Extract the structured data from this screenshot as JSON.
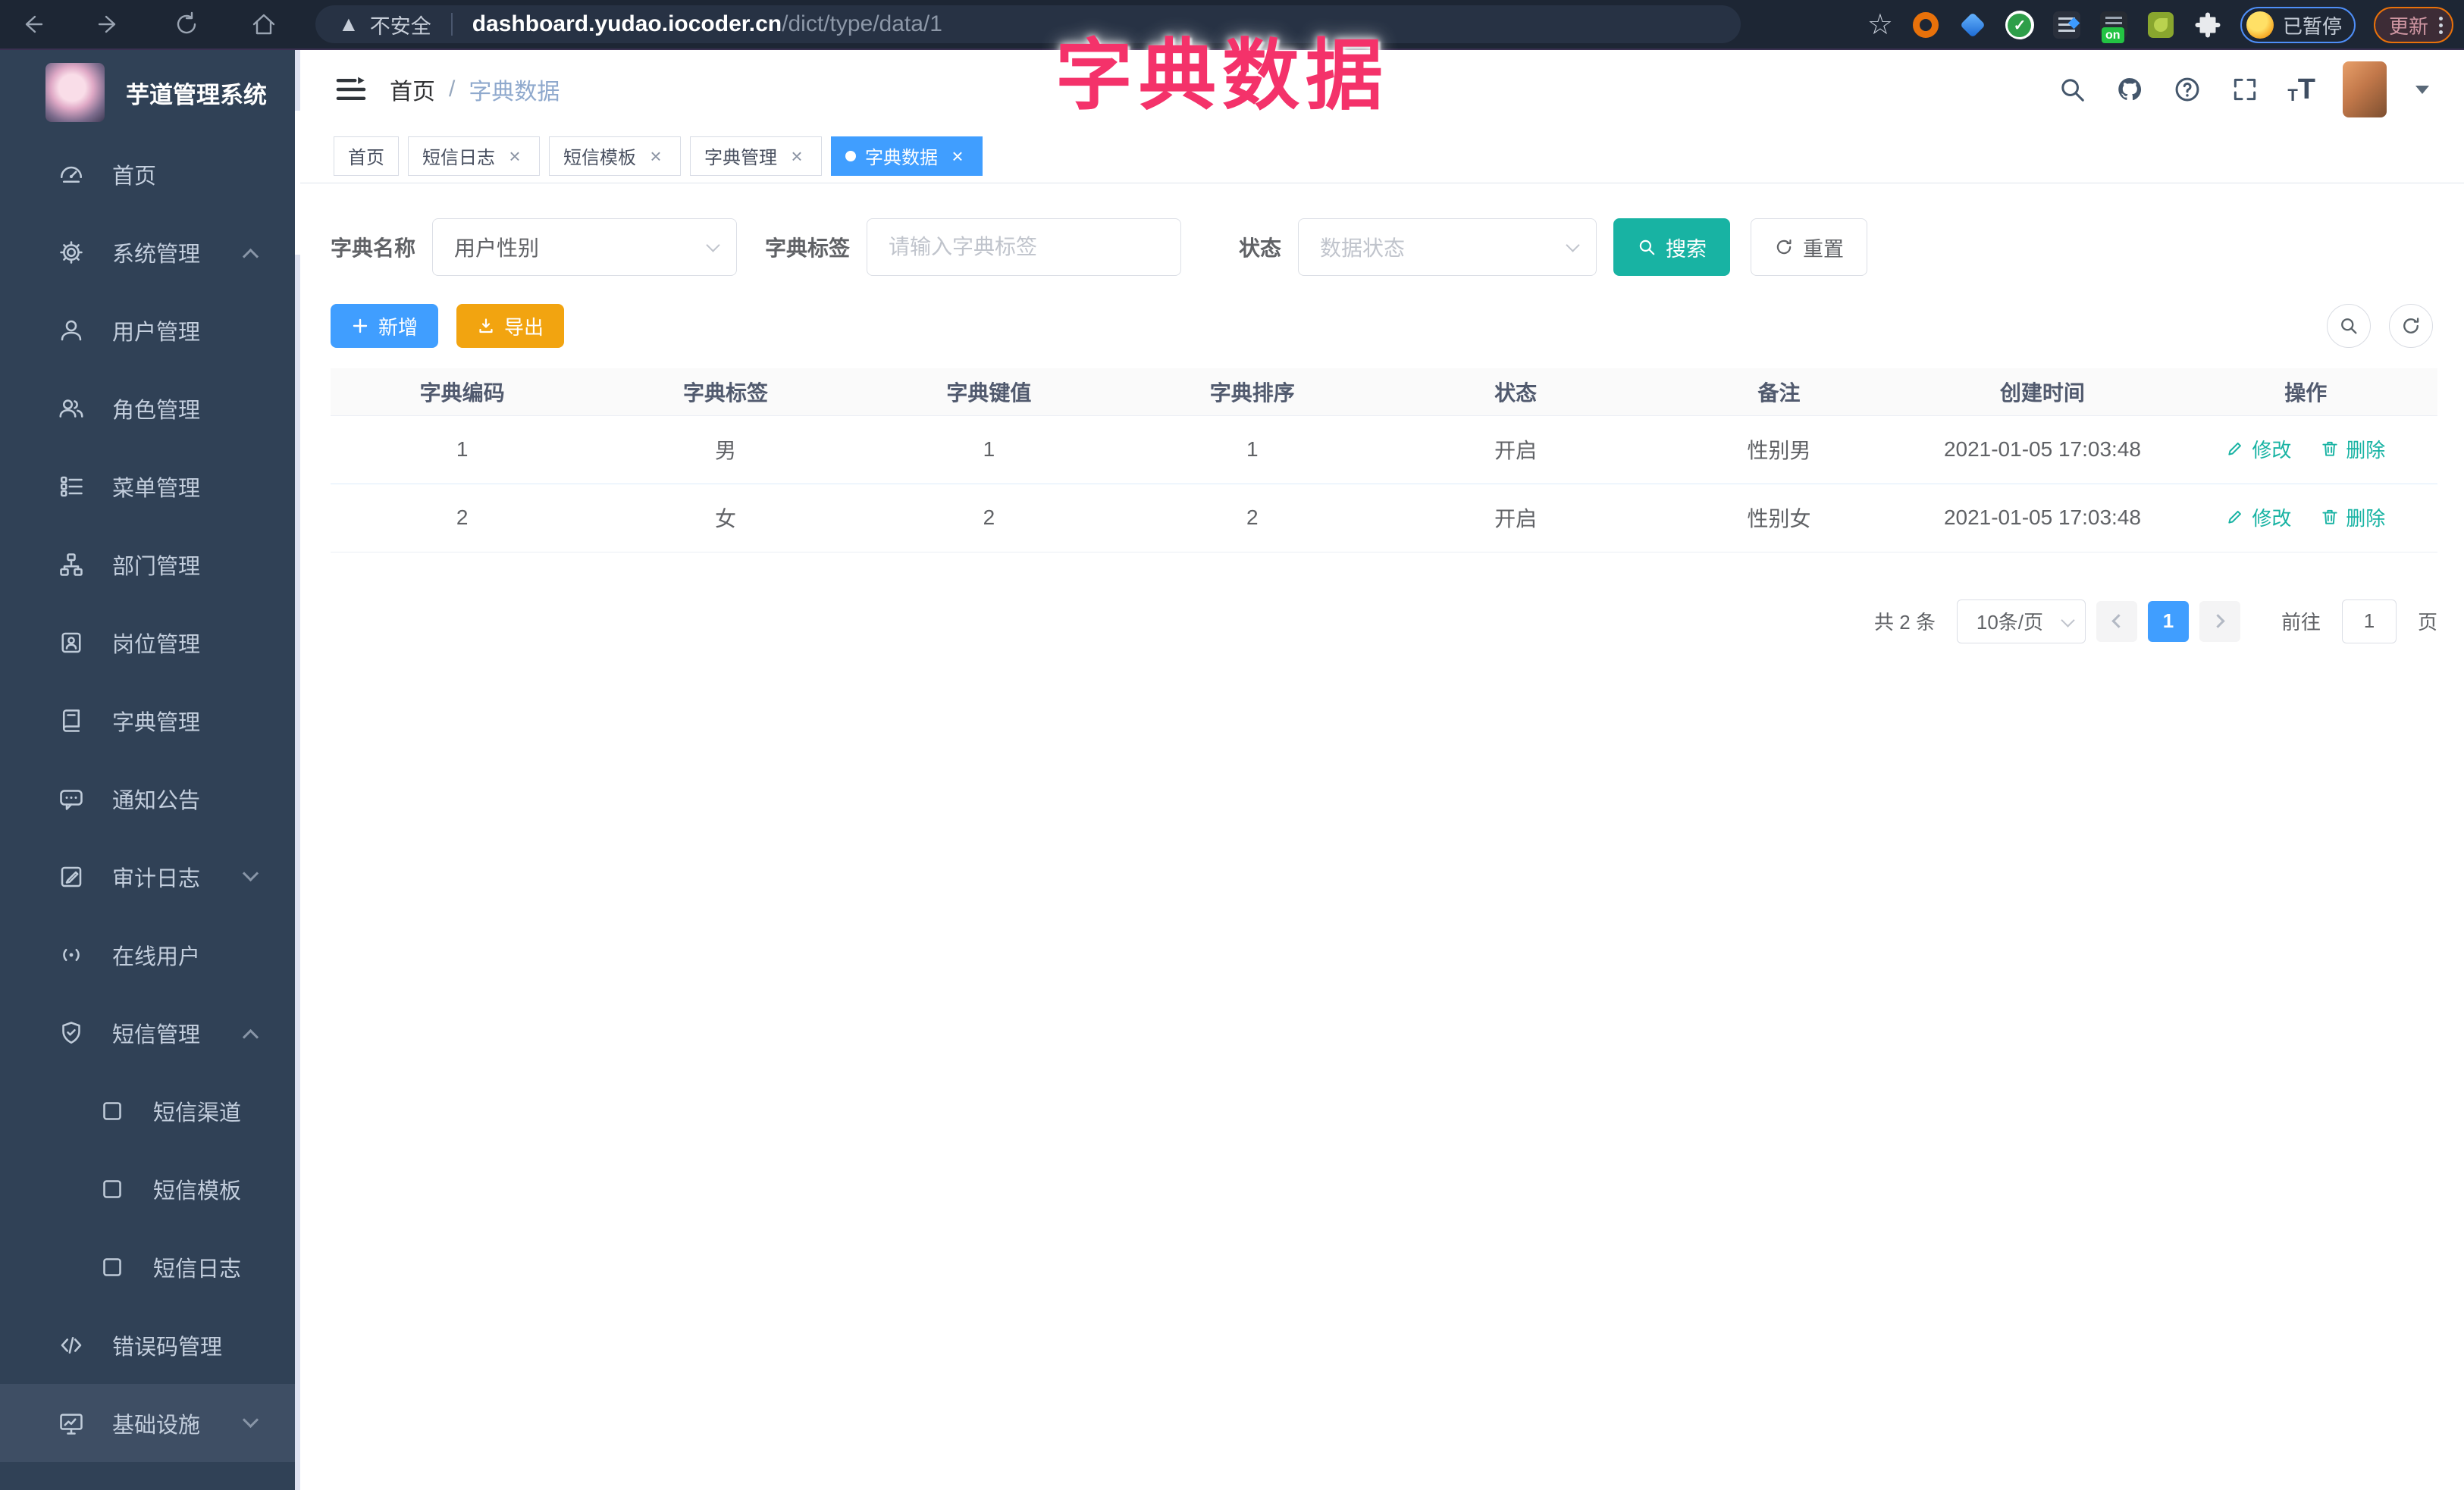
{
  "browser": {
    "security_label": "不安全",
    "url_host": "dashboard.yudao.iocoder.cn",
    "url_path": "/dict/type/data/1",
    "on_badge": "on",
    "paused_label": "已暂停",
    "update_label": "更新"
  },
  "overlay": {
    "title": "字典数据"
  },
  "sidebar": {
    "app_title": "芋道管理系统",
    "items": [
      {
        "label": "首页"
      },
      {
        "label": "系统管理"
      },
      {
        "label": "用户管理"
      },
      {
        "label": "角色管理"
      },
      {
        "label": "菜单管理"
      },
      {
        "label": "部门管理"
      },
      {
        "label": "岗位管理"
      },
      {
        "label": "字典管理"
      },
      {
        "label": "通知公告"
      },
      {
        "label": "审计日志"
      },
      {
        "label": "在线用户"
      },
      {
        "label": "短信管理"
      },
      {
        "label": "短信渠道"
      },
      {
        "label": "短信模板"
      },
      {
        "label": "短信日志"
      },
      {
        "label": "错误码管理"
      },
      {
        "label": "基础设施"
      }
    ]
  },
  "breadcrumb": {
    "home": "首页",
    "separator": "/",
    "current": "字典数据"
  },
  "tabs": [
    {
      "label": "首页"
    },
    {
      "label": "短信日志"
    },
    {
      "label": "短信模板"
    },
    {
      "label": "字典管理"
    },
    {
      "label": "字典数据"
    }
  ],
  "filters": {
    "name_label": "字典名称",
    "name_value": "用户性别",
    "tag_label": "字典标签",
    "tag_placeholder": "请输入字典标签",
    "status_label": "状态",
    "status_placeholder": "数据状态",
    "search_label": "搜索",
    "reset_label": "重置"
  },
  "toolbar": {
    "add_label": "新增",
    "export_label": "导出"
  },
  "table": {
    "headers": [
      "字典编码",
      "字典标签",
      "字典键值",
      "字典排序",
      "状态",
      "备注",
      "创建时间",
      "操作"
    ],
    "rows": [
      {
        "code": "1",
        "label": "男",
        "value": "1",
        "sort": "1",
        "status": "开启",
        "remark": "性别男",
        "created": "2021-01-05 17:03:48"
      },
      {
        "code": "2",
        "label": "女",
        "value": "2",
        "sort": "2",
        "status": "开启",
        "remark": "性别女",
        "created": "2021-01-05 17:03:48"
      }
    ],
    "edit_label": "修改",
    "delete_label": "删除"
  },
  "pagination": {
    "total_text": "共 2 条",
    "page_size_text": "10条/页",
    "current_page": "1",
    "goto_label": "前往",
    "goto_value": "1",
    "unit_label": "页"
  },
  "colors": {
    "primary": "#409eff",
    "theme_teal": "#18b3a3",
    "warning_orange": "#f2a410",
    "overlay_pink": "#f4326a",
    "sidebar_bg": "#304156"
  }
}
